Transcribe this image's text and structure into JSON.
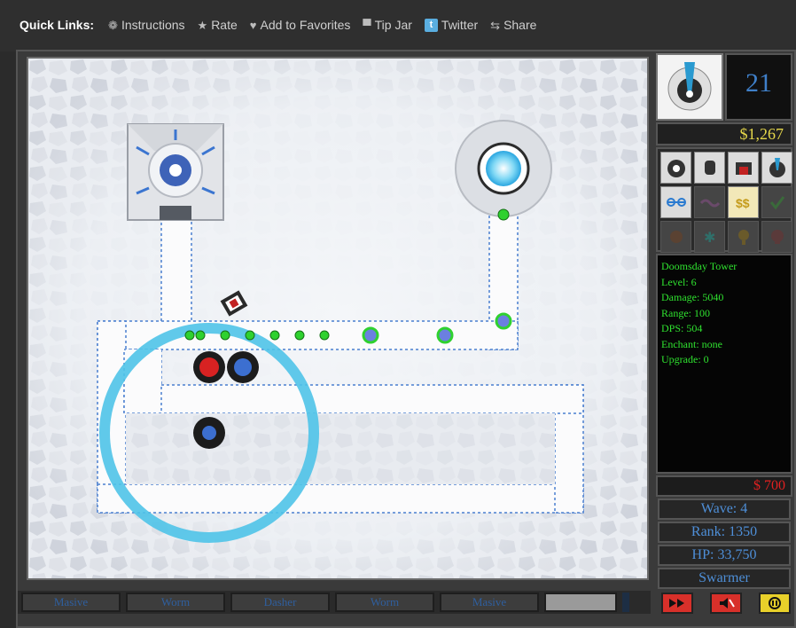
{
  "quick_links": {
    "title": "Quick Links:",
    "items": [
      {
        "label": "Instructions",
        "icon": "gear-icon"
      },
      {
        "label": "Rate",
        "icon": "star-icon"
      },
      {
        "label": "Add to Favorites",
        "icon": "heart-icon"
      },
      {
        "label": "Tip Jar",
        "icon": "jar-icon"
      },
      {
        "label": "Twitter",
        "icon": "twitter-icon"
      },
      {
        "label": "Share",
        "icon": "share-icon"
      }
    ]
  },
  "panel": {
    "counter": "21",
    "money": "$1,267",
    "tower_info": {
      "name": "Doomsday Tower",
      "level": "Level: 6",
      "damage": "Damage: 5040",
      "range": "Range: 100",
      "dps": "DPS: 504",
      "enchant": "Enchant: none",
      "upgrade": "Upgrade: 0"
    },
    "sell_value": "$ 700",
    "wave": "Wave: 4",
    "rank": "Rank: 1350",
    "hp": "HP: 33,750",
    "enemy_type": "Swarmer"
  },
  "wave_bar": {
    "segments": [
      "Masive",
      "Worm",
      "Dasher",
      "Worm",
      "Masive"
    ]
  },
  "colors": {
    "money": "#e6d84a",
    "info_text": "#2fe22f",
    "sell": "#e02020",
    "stat_text": "#4e8fd8",
    "range_ring": "#4fc3e8"
  }
}
